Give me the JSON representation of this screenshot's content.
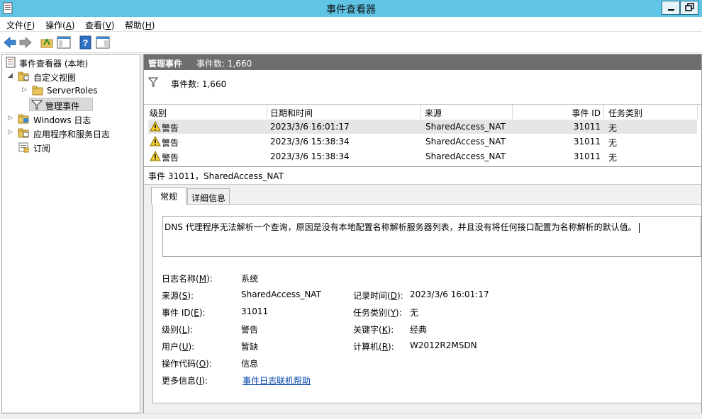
{
  "window": {
    "title": "事件查看器",
    "min_label": "",
    "max_label": ""
  },
  "menu": [
    {
      "label": "文件(",
      "key": "F",
      "tail": ")"
    },
    {
      "label": "操作(",
      "key": "A",
      "tail": ")"
    },
    {
      "label": "查看(",
      "key": "V",
      "tail": ")"
    },
    {
      "label": "帮助(",
      "key": "H",
      "tail": ")"
    }
  ],
  "tree": {
    "root": "事件查看器 (本地)",
    "custom_views": "自定义视图",
    "server_roles": "ServerRoles",
    "admin_events": "管理事件",
    "windows_logs": "Windows 日志",
    "app_logs": "应用程序和服务日志",
    "subscriptions": "订阅"
  },
  "header": {
    "title": "管理事件",
    "count": "事件数: 1,660"
  },
  "filter": {
    "label": "事件数: 1,660"
  },
  "columns": {
    "level": "级别",
    "datetime": "日期和时间",
    "source": "来源",
    "event_id": "事件 ID",
    "task": "任务类别"
  },
  "rows": [
    {
      "level": "警告",
      "datetime": "2023/3/6 16:01:17",
      "source": "SharedAccess_NAT",
      "event_id": "31011",
      "task": "无"
    },
    {
      "level": "警告",
      "datetime": "2023/3/6 15:38:34",
      "source": "SharedAccess_NAT",
      "event_id": "31011",
      "task": "无"
    },
    {
      "level": "警告",
      "datetime": "2023/3/6 15:38:34",
      "source": "SharedAccess_NAT",
      "event_id": "31011",
      "task": "无"
    }
  ],
  "detail": {
    "title": "事件 31011，SharedAccess_NAT",
    "tabs": {
      "general": "常规",
      "details": "详细信息"
    },
    "message": "DNS 代理程序无法解析一个查询，原因是没有本地配置名称解析服务器列表，并且没有将任何接口配置为名称解析的默认值。",
    "props": {
      "log_name_label": "日志名称(",
      "log_name_key": "M",
      "log_name_tail": "):",
      "log_name": "系统",
      "source_label": "来源(",
      "source_key": "S",
      "source_tail": "):",
      "source": "SharedAccess_NAT",
      "recorded_label": "记录时间(",
      "recorded_key": "D",
      "recorded_tail": "):",
      "recorded": "2023/3/6 16:01:17",
      "event_id_label": "事件 ID(",
      "event_id_key": "E",
      "event_id_tail": "):",
      "event_id": "31011",
      "task_label": "任务类别(",
      "task_key": "Y",
      "task_tail": "):",
      "task": "无",
      "level_label": "级别(",
      "level_key": "L",
      "level_tail": "):",
      "level": "警告",
      "keywords_label": "关键字(",
      "keywords_key": "K",
      "keywords_tail": "):",
      "keywords": "经典",
      "user_label": "用户(",
      "user_key": "U",
      "user_tail": "):",
      "user": "暂缺",
      "computer_label": "计算机(",
      "computer_key": "R",
      "computer_tail": "):",
      "computer": "W2012R2MSDN",
      "opcode_label": "操作代码(",
      "opcode_key": "O",
      "opcode_tail": "):",
      "opcode": "信息",
      "more_label": "更多信息(",
      "more_key": "I",
      "more_tail": "):",
      "more_link": "事件日志联机帮助"
    }
  }
}
